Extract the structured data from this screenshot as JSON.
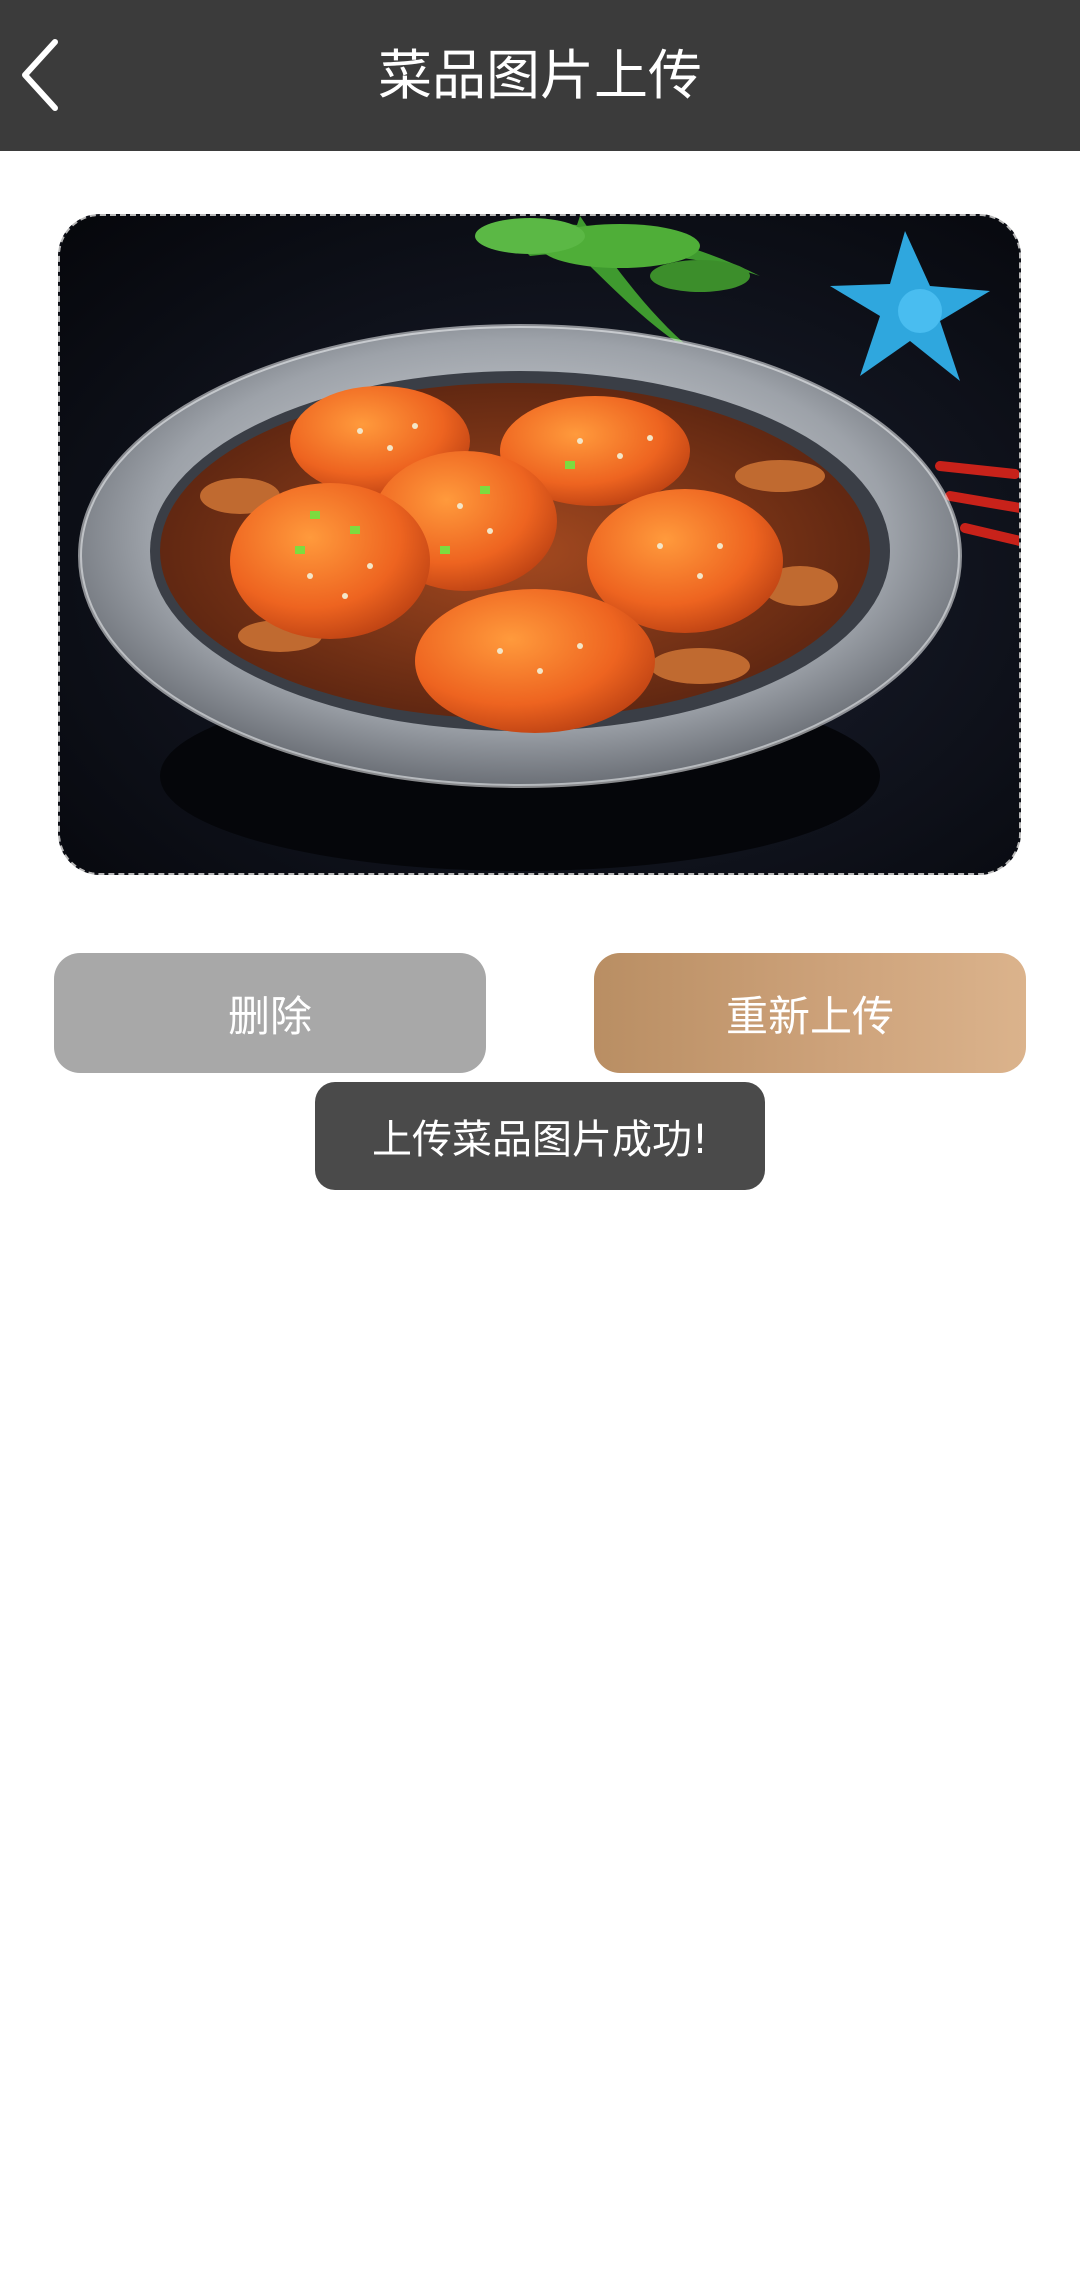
{
  "header": {
    "title": "菜品图片上传",
    "back_icon": "chevron-left-icon"
  },
  "photo": {
    "subject": "dish-photo",
    "accent_colors": [
      "#e2551c",
      "#c2c6cc",
      "#2fb3e4",
      "#3a8b2c"
    ]
  },
  "actions": {
    "delete_label": "删除",
    "reupload_label": "重新上传",
    "delete_color": "#a8a8a8",
    "reupload_color": "#c99e74"
  },
  "toast": {
    "message": "上传菜品图片成功!"
  },
  "colors": {
    "header_bg": "#3b3b3b",
    "page_bg": "#ffffff",
    "toast_bg": "#4a4a4a"
  }
}
